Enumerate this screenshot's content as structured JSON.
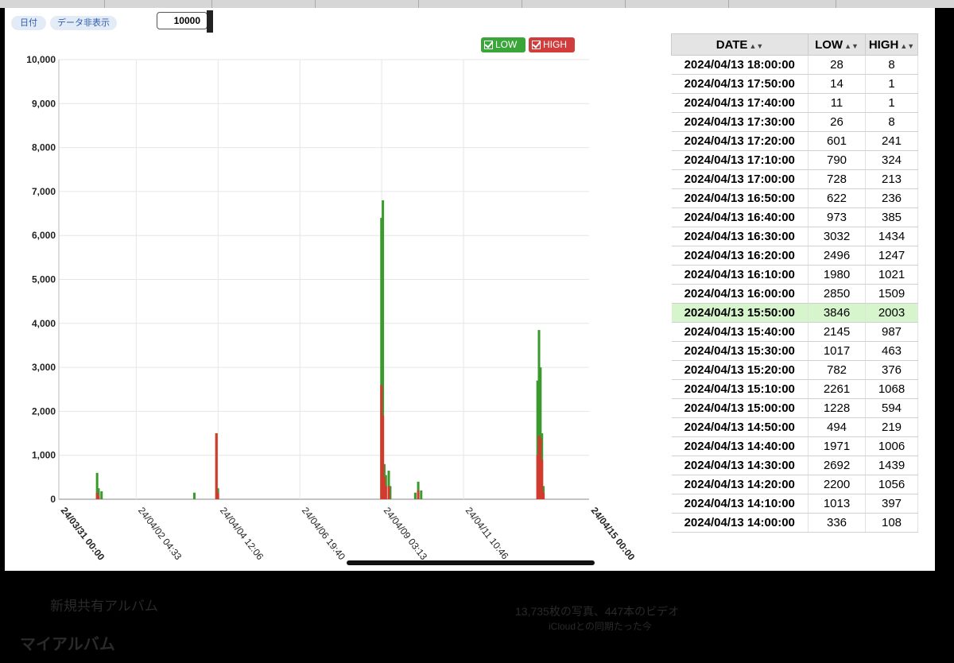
{
  "toolbar": {
    "date_button": "日付",
    "hide_data_button": "データ非表示",
    "input_value": "10000"
  },
  "legend": {
    "low_label": "LOW",
    "high_label": "HIGH"
  },
  "colors": {
    "low": "#3a9a2e",
    "high": "#d33a2f",
    "legend_low": "#3aa63a",
    "legend_high": "#d13c3c",
    "highlight_row": "#d7f5cc"
  },
  "chart_data": {
    "type": "bar",
    "xlabel": "",
    "ylabel": "",
    "ylim": [
      0,
      10000
    ],
    "y_ticks": [
      "0",
      "1,000",
      "2,000",
      "3,000",
      "4,000",
      "5,000",
      "6,000",
      "7,000",
      "8,000",
      "9,000",
      "10,000"
    ],
    "x_ticks": [
      "24/03/31 00:00",
      "24/04/02 04:33",
      "24/04/04 12:06",
      "24/04/06 19:40",
      "24/04/09 03:13",
      "24/04/11 10:46",
      "24/04/15 00:00"
    ],
    "x_range": [
      "2024-03-31 00:00",
      "2024-04-15 00:00"
    ],
    "grid": true,
    "legend_position": "top-right",
    "series": [
      {
        "name": "LOW",
        "color": "#3a9a2e",
        "points": [
          [
            "2024-04-01 02:00",
            600
          ],
          [
            "2024-04-01 03:00",
            250
          ],
          [
            "2024-04-01 05:00",
            180
          ],
          [
            "2024-04-03 20:00",
            150
          ],
          [
            "2024-04-04 11:00",
            1500
          ],
          [
            "2024-04-04 12:00",
            250
          ],
          [
            "2024-04-09 03:00",
            6400
          ],
          [
            "2024-04-09 04:00",
            6800
          ],
          [
            "2024-04-09 05:00",
            800
          ],
          [
            "2024-04-09 06:00",
            550
          ],
          [
            "2024-04-09 08:00",
            650
          ],
          [
            "2024-04-09 09:00",
            300
          ],
          [
            "2024-04-10 02:00",
            150
          ],
          [
            "2024-04-10 04:00",
            400
          ],
          [
            "2024-04-10 06:00",
            200
          ],
          [
            "2024-04-13 13:00",
            2700
          ],
          [
            "2024-04-13 14:00",
            3850
          ],
          [
            "2024-04-13 15:00",
            3000
          ],
          [
            "2024-04-13 16:00",
            1500
          ],
          [
            "2024-04-13 17:00",
            300
          ]
        ]
      },
      {
        "name": "HIGH",
        "color": "#d33a2f",
        "points": [
          [
            "2024-04-01 02:00",
            150
          ],
          [
            "2024-04-01 03:00",
            60
          ],
          [
            "2024-04-04 11:00",
            1500
          ],
          [
            "2024-04-04 12:00",
            150
          ],
          [
            "2024-04-09 03:00",
            2600
          ],
          [
            "2024-04-09 04:00",
            1900
          ],
          [
            "2024-04-09 05:00",
            500
          ],
          [
            "2024-04-09 06:00",
            300
          ],
          [
            "2024-04-09 08:00",
            300
          ],
          [
            "2024-04-10 04:00",
            200
          ],
          [
            "2024-04-13 13:00",
            1000
          ],
          [
            "2024-04-13 14:00",
            1450
          ],
          [
            "2024-04-13 15:00",
            1400
          ],
          [
            "2024-04-13 16:00",
            900
          ],
          [
            "2024-04-13 17:00",
            150
          ]
        ]
      }
    ]
  },
  "table": {
    "columns": [
      "DATE",
      "LOW",
      "HIGH"
    ],
    "rows": [
      [
        "2024/04/13 18:00:00",
        "28",
        "8"
      ],
      [
        "2024/04/13 17:50:00",
        "14",
        "1"
      ],
      [
        "2024/04/13 17:40:00",
        "11",
        "1"
      ],
      [
        "2024/04/13 17:30:00",
        "26",
        "8"
      ],
      [
        "2024/04/13 17:20:00",
        "601",
        "241"
      ],
      [
        "2024/04/13 17:10:00",
        "790",
        "324"
      ],
      [
        "2024/04/13 17:00:00",
        "728",
        "213"
      ],
      [
        "2024/04/13 16:50:00",
        "622",
        "236"
      ],
      [
        "2024/04/13 16:40:00",
        "973",
        "385"
      ],
      [
        "2024/04/13 16:30:00",
        "3032",
        "1434"
      ],
      [
        "2024/04/13 16:20:00",
        "2496",
        "1247"
      ],
      [
        "2024/04/13 16:10:00",
        "1980",
        "1021"
      ],
      [
        "2024/04/13 16:00:00",
        "2850",
        "1509"
      ],
      [
        "2024/04/13 15:50:00",
        "3846",
        "2003"
      ],
      [
        "2024/04/13 15:40:00",
        "2145",
        "987"
      ],
      [
        "2024/04/13 15:30:00",
        "1017",
        "463"
      ],
      [
        "2024/04/13 15:20:00",
        "782",
        "376"
      ],
      [
        "2024/04/13 15:10:00",
        "2261",
        "1068"
      ],
      [
        "2024/04/13 15:00:00",
        "1228",
        "594"
      ],
      [
        "2024/04/13 14:50:00",
        "494",
        "219"
      ],
      [
        "2024/04/13 14:40:00",
        "1971",
        "1006"
      ],
      [
        "2024/04/13 14:30:00",
        "2692",
        "1439"
      ],
      [
        "2024/04/13 14:20:00",
        "2200",
        "1056"
      ],
      [
        "2024/04/13 14:10:00",
        "1013",
        "397"
      ],
      [
        "2024/04/13 14:00:00",
        "336",
        "108"
      ]
    ],
    "selected_row": 13
  },
  "background": {
    "album_text": "新規共有アルバム",
    "my_album": "マイアルバム",
    "summary": "13,735枚の写真、447本のビデオ",
    "icloud": "iCloudとの同期たった今"
  }
}
